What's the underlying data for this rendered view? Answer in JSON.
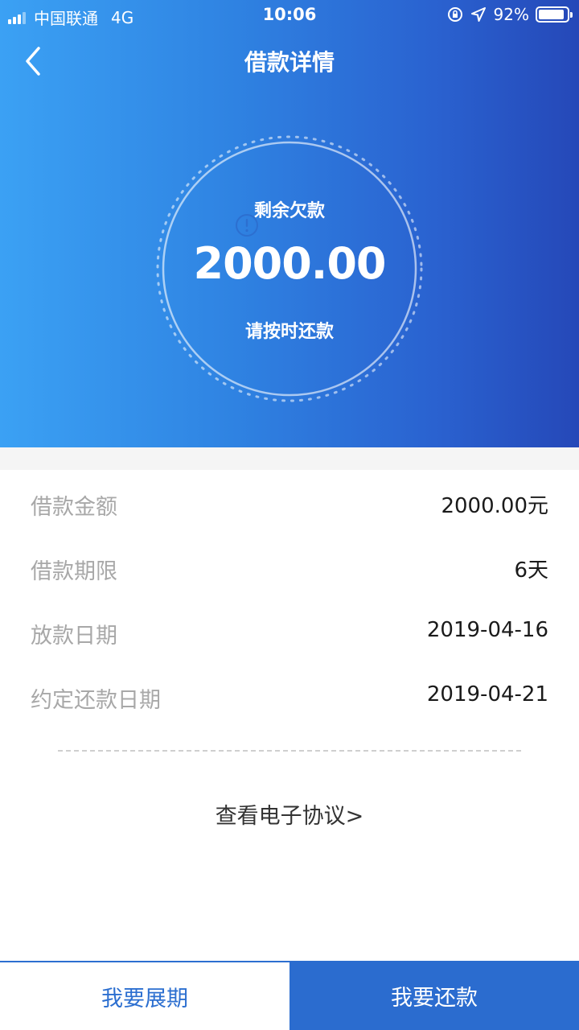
{
  "status_bar": {
    "carrier": "中国联通",
    "network": "4G",
    "time": "10:06",
    "battery": "92%",
    "battery_level": 0.92
  },
  "nav": {
    "title": "借款详情",
    "back_icon": "chevron-left-icon"
  },
  "summary": {
    "label": "剩余欠款",
    "amount": "2000.00",
    "note": "请按时还款"
  },
  "details": [
    {
      "label": "借款金额",
      "value": "2000.00元"
    },
    {
      "label": "借款期限",
      "value": "6天"
    },
    {
      "label": "放款日期",
      "value": "2019-04-16"
    },
    {
      "label": "约定还款日期",
      "value": "2019-04-21",
      "icon": "info-icon"
    }
  ],
  "agreement_link": "查看电子协议>",
  "buttons": {
    "extend": "我要展期",
    "repay": "我要还款"
  },
  "colors": {
    "accent": "#2c6fd0",
    "gradient_start": "#3ba1f4",
    "gradient_end": "#2548b8",
    "label_gray": "#a8a8a8"
  }
}
